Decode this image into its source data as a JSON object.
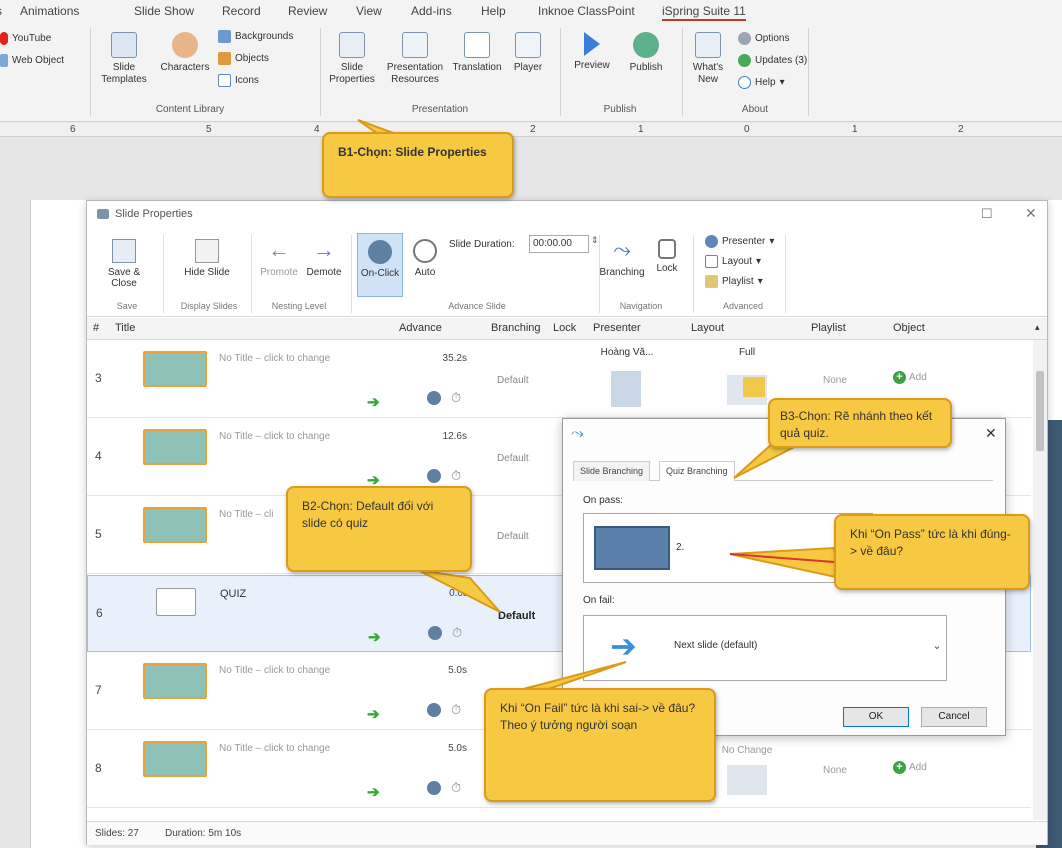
{
  "menubar": {
    "items": [
      "Animations",
      "Slide Show",
      "Record",
      "Review",
      "View",
      "Add-ins",
      "Help",
      "Inknoe ClassPoint",
      "iSpring Suite 11"
    ]
  },
  "ribbon": {
    "web_items": [
      "YouTube",
      "Web Object"
    ],
    "content_library": {
      "label": "Content Library",
      "slide_templates": "Slide Templates",
      "characters": "Characters",
      "backgrounds": "Backgrounds",
      "objects": "Objects",
      "icons": "Icons"
    },
    "presentation": {
      "label": "Presentation",
      "slide_properties": "Slide Properties",
      "presentation_resources": "Presentation Resources",
      "translation": "Translation",
      "player": "Player"
    },
    "publish": {
      "label": "Publish",
      "preview": "Preview",
      "publish": "Publish"
    },
    "about": {
      "label": "About",
      "whats_new": "What's New",
      "options": "Options",
      "updates": "Updates (3)",
      "help": "Help"
    }
  },
  "ruler": [
    "6",
    "5",
    "4",
    "2",
    "1",
    "0",
    "1",
    "2"
  ],
  "slide_properties": {
    "title": "Slide Properties",
    "toolbar": {
      "save_close": "Save & Close",
      "hide_slide": "Hide Slide",
      "promote": "Promote",
      "demote": "Demote",
      "on_click": "On-Click",
      "auto": "Auto",
      "slide_duration_label": "Slide Duration:",
      "slide_duration_value": "00:00.00",
      "branching": "Branching",
      "lock": "Lock",
      "presenter": "Presenter",
      "layout": "Layout",
      "playlist": "Playlist",
      "groups": {
        "save": "Save",
        "display": "Display Slides",
        "nesting": "Nesting Level",
        "advance": "Advance Slide",
        "navigation": "Navigation",
        "advanced": "Advanced"
      }
    },
    "columns": [
      "#",
      "Title",
      "Advance",
      "Branching",
      "Lock",
      "Presenter",
      "Layout",
      "Playlist",
      "Object"
    ],
    "rows": [
      {
        "num": "3",
        "title": "No Title – click to change",
        "advance": "35.2s",
        "branching": "Default",
        "presenter": "Hoàng Vă...",
        "layout": "Full",
        "playlist": "None",
        "object": "Add"
      },
      {
        "num": "4",
        "title": "No Title – click to change",
        "advance": "12.6s",
        "branching": "Default"
      },
      {
        "num": "5",
        "title": "No Title – cli",
        "advance": "",
        "branching": "Default"
      },
      {
        "num": "6",
        "title": "QUIZ",
        "advance": "0.0s",
        "branching": "Default"
      },
      {
        "num": "7",
        "title": "No Title – click to change",
        "advance": "5.0s",
        "branching": ""
      },
      {
        "num": "8",
        "title": "No Title – click to change",
        "advance": "5.0s",
        "branching": "",
        "layout": "No Change",
        "playlist": "None",
        "object": "Add"
      }
    ],
    "status": {
      "slides": "Slides: 27",
      "duration": "Duration: 5m 10s"
    }
  },
  "branching_dialog": {
    "tabs": [
      "Slide Branching",
      "Quiz Branching"
    ],
    "on_pass_label": "On pass:",
    "on_pass_value": "2.",
    "on_fail_label": "On fail:",
    "on_fail_value": "Next slide (default)",
    "ok": "OK",
    "cancel": "Cancel"
  },
  "callouts": {
    "b1": "B1-Chọn: Slide Properties",
    "b2": "B2-Chọn: Default đối với slide có quiz",
    "b3": "B3-Chọn: Rẽ nhánh theo kết quả quiz.",
    "on_pass": "Khi “On Pass” tức là khi đúng-> về đâu?",
    "on_fail": "Khi “On Fail” tức là khi sai-> về đâu? Theo ý tưởng người soạn"
  },
  "colors": {
    "callout_fill": "#f7c842",
    "callout_border": "#d99b18",
    "pointer_red": "#d9352b",
    "accent_green": "#34a83b",
    "selection": "#e8f1fb"
  }
}
